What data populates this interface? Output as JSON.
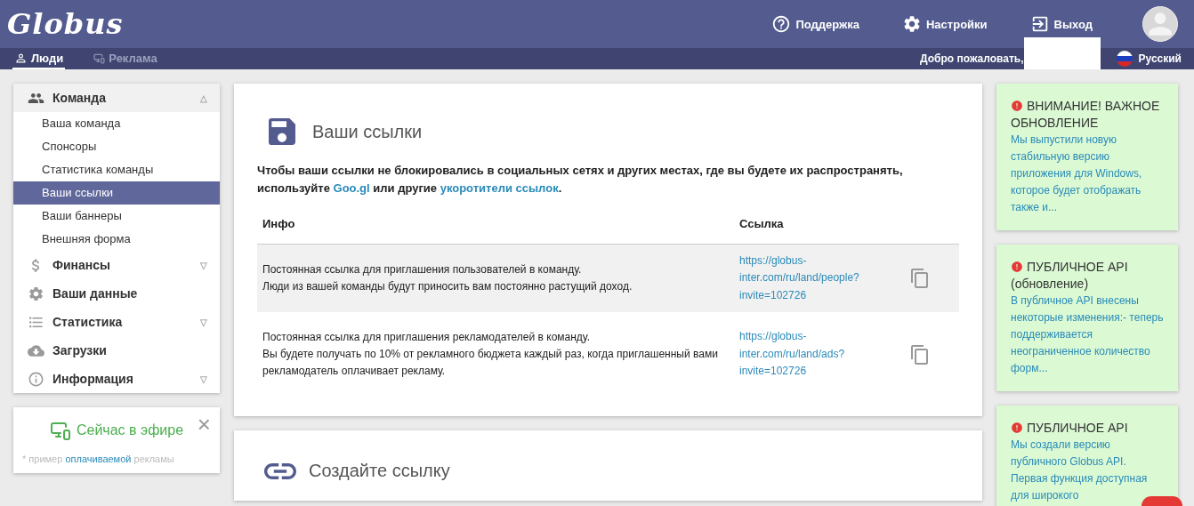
{
  "header": {
    "logo": "Globus",
    "nav": [
      {
        "kind": "help",
        "label": "Поддержка"
      },
      {
        "kind": "settings",
        "label": "Настройки"
      },
      {
        "kind": "logout",
        "label": "Выход"
      }
    ]
  },
  "subbar": {
    "tabs": [
      {
        "kind": "person",
        "label": "Люди",
        "selected": true
      },
      {
        "kind": "monitor",
        "label": "Реклама",
        "selected": false
      }
    ],
    "welcome": "Добро пожаловать,",
    "language": "Русский"
  },
  "sidebar": {
    "items": [
      {
        "kind": "people",
        "label": "Команда",
        "expanded": true,
        "arrow": "△",
        "children": [
          {
            "label": "Ваша команда",
            "selected": false
          },
          {
            "label": "Спонсоры",
            "selected": false
          },
          {
            "label": "Статистика команды",
            "selected": false
          },
          {
            "label": "Ваши ссылки",
            "selected": true
          },
          {
            "label": "Ваши баннеры",
            "selected": false
          },
          {
            "label": "Внешняя форма",
            "selected": false
          }
        ]
      },
      {
        "kind": "dollar",
        "label": "Финансы",
        "expanded": false,
        "arrow": "▽"
      },
      {
        "kind": "gear",
        "label": "Ваши данные",
        "expanded": false
      },
      {
        "kind": "list",
        "label": "Статистика",
        "expanded": false,
        "arrow": "▽"
      },
      {
        "kind": "cloud",
        "label": "Загрузки",
        "expanded": false
      },
      {
        "kind": "info",
        "label": "Информация",
        "expanded": false,
        "arrow": "▽"
      }
    ]
  },
  "ad_box": {
    "title": "Сейчас в эфире",
    "close": "×",
    "note_before": "* пример",
    "note_link": "оплачиваемой",
    "note_after": "рекламы"
  },
  "links_card": {
    "title": "Ваши ссылки",
    "intro": [
      {
        "kind": "text",
        "text": "Чтобы ваши ссылки не блокировались в социальных сетях и других местах, где вы будете их распространять, используйте "
      },
      {
        "kind": "link",
        "text": "Goo.gl"
      },
      {
        "kind": "text",
        "text": " или другие "
      },
      {
        "kind": "link",
        "text": "укоротители ссылок"
      },
      {
        "kind": "text",
        "text": "."
      }
    ],
    "columns": [
      "Инфо",
      "Ссылка"
    ],
    "rows": [
      {
        "info": [
          "Постоянная ссылка для приглашения пользователей в команду.",
          "Люди из вашей команды будут приносить вам постоянно растущий доход."
        ],
        "link": "https://globus-inter.com/ru/land/people?invite=102726",
        "selected": true
      },
      {
        "info": [
          "Постоянная ссылка для приглашения рекламодателей в команду.",
          "Вы будете получать по 10% от рекламного бюджета каждый раз, когда приглашенный вами рекламодатель оплачивает рекламу."
        ],
        "link": "https://globus-inter.com/ru/land/ads?invite=102726",
        "selected": false
      }
    ]
  },
  "create_card": {
    "title": "Создайте ссылку"
  },
  "news": [
    {
      "title": "ВНИМАНИЕ! ВАЖНОЕ ОБНОВЛЕНИЕ",
      "text": "Мы выпустили новую стабильную версию приложения для Windows, которое будет отображать также и..."
    },
    {
      "title": "ПУБЛИЧНОЕ API (обновление)",
      "text": "В публичное API внесены некоторые изменения:- теперь поддерживается неограниченное количество форм..."
    },
    {
      "title": "ПУБЛИЧНОЕ API",
      "text": "Мы создали версию публичного Globus API. Первая функция доступная для широкого"
    }
  ]
}
